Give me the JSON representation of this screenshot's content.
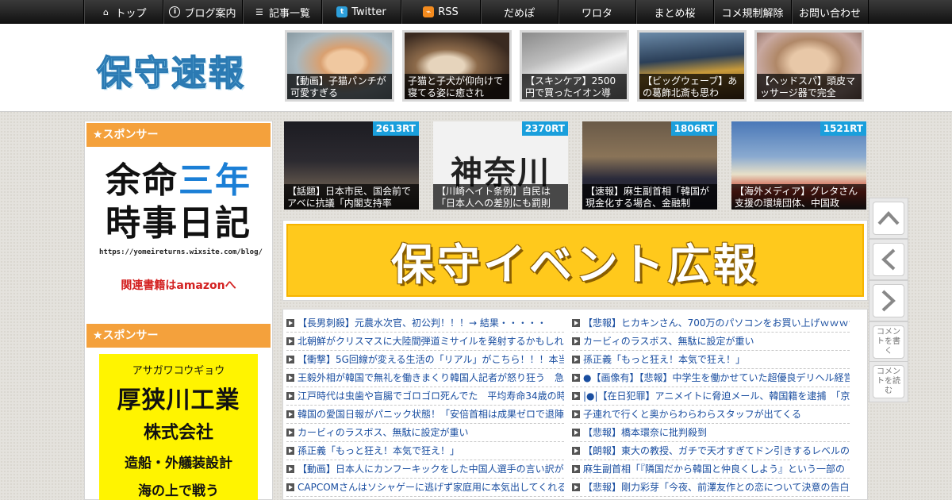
{
  "nav": {
    "items": [
      {
        "label": "トップ",
        "icon": "home-icon"
      },
      {
        "label": "ブログ案内",
        "icon": "info-icon"
      },
      {
        "label": "記事一覧",
        "icon": "list-icon"
      },
      {
        "label": "Twitter",
        "icon": "twitter-icon"
      },
      {
        "label": "RSS",
        "icon": "rss-icon"
      },
      {
        "label": "だめぽ"
      },
      {
        "label": "ワロタ"
      },
      {
        "label": "まとめ桜"
      },
      {
        "label": "コメ規制解除"
      },
      {
        "label": "お問い合わせ"
      }
    ]
  },
  "header": {
    "logo": "保守速報",
    "thumbs": [
      {
        "caption": "【動画】子猫パンチが可愛すぎる"
      },
      {
        "caption": "子猫と子犬が仰向けで寝てる姿に癒され"
      },
      {
        "caption": "【スキンケア】2500円で買ったイオン導"
      },
      {
        "caption": "【ビッグウェーブ】あの葛飾北斎も思わ"
      },
      {
        "caption": "【ヘッドスパ】頭皮マッサージ器で完全"
      }
    ]
  },
  "sidebar": {
    "sponsor1": {
      "heading": "★スポンサー",
      "line1a": "余命",
      "line1b": "三年",
      "line2": "時事日記",
      "url": "https://yomeireturns.wixsite.com/blog/",
      "amazon": "関連書籍はamazonへ"
    },
    "sponsor2": {
      "heading": "★スポンサー",
      "kana": "アサガワコウギョウ",
      "name": "厚狭川工業",
      "corp": "株式会社",
      "biz": "造船・外艤装設計",
      "cut": "海の上で戦う"
    }
  },
  "ranking": [
    {
      "rt": "2613RT",
      "caption": "【話題】日本市民、国会前でアベに抗議「内閣支持率"
    },
    {
      "rt": "2370RT",
      "caption": "【川崎ヘイト条例】自民は「日本人への差別にも罰則"
    },
    {
      "rt": "1806RT",
      "caption": "【速報】麻生副首相「韓国が現金化する場合、金融制"
    },
    {
      "rt": "1521RT",
      "caption": "【海外メディア】グレタさん支援の環境団体、中国政"
    }
  ],
  "banner": {
    "text": "保守イベント広報"
  },
  "headlines": {
    "left": [
      "【長男刺殺】元農水次官、初公判！！！→ 結果・・・・・",
      "北朝鮮がクリスマスに大陸間弾道ミサイルを発射するかもしれ",
      "【衝撃】5G回線が変える生活の「リアル」がこちら！！！本当",
      "王毅外相が韓国で無礼を働きまくり韓国人記者が怒り狂う　急",
      "江戸時代は虫歯や盲腸でゴロゴロ死んでた　平均寿命34歳の時",
      "韓国の愛国日報がパニック状態！「安倍首相は成果ゼロで退陣",
      "カービィのラスボス、無駄に設定が重い",
      "孫正義「もっと狂え！本気で狂え！」",
      "【動画】日本人にカンフーキックをした中国人選手の言い訳が",
      "CAPCOMさんはソシャゲーに逃げず家庭用に本気出してくれる"
    ],
    "right": [
      "【悲報】ヒカキンさん、700万のパソコンをお買い上げｗｗｗｗ",
      "カービィのラスボス、無駄に設定が重い",
      "孫正義「もっと狂え！本気で狂え！」",
      "●【画像有】【悲報】中学生を働かせていた超優良デリヘル経営",
      "|●|【在日犯罪】アニメイトに脅迫メール、韓国籍を逮捕　「京",
      "子連れで行くと奥からわらわらスタッフが出てくる",
      "【悲報】橋本環奈に批判殺到",
      "【朗報】東大の教授、ガチで天才すぎてドン引きするレベルの",
      "麻生副首相「『隣国だから韓国と仲良くしよう』という一部の",
      "【悲報】剛力彩芽「今夜、前澤友作との恋について決意の告白"
    ]
  },
  "side_buttons": [
    {
      "name": "scroll-up-button",
      "icon": "chevron-up-icon"
    },
    {
      "name": "prev-button",
      "icon": "chevron-left-icon"
    },
    {
      "name": "next-button",
      "icon": "chevron-right-icon"
    },
    {
      "name": "write-comment-button",
      "label": "コメントを書く"
    },
    {
      "name": "read-comment-button",
      "label": "コメントを読む"
    }
  ]
}
